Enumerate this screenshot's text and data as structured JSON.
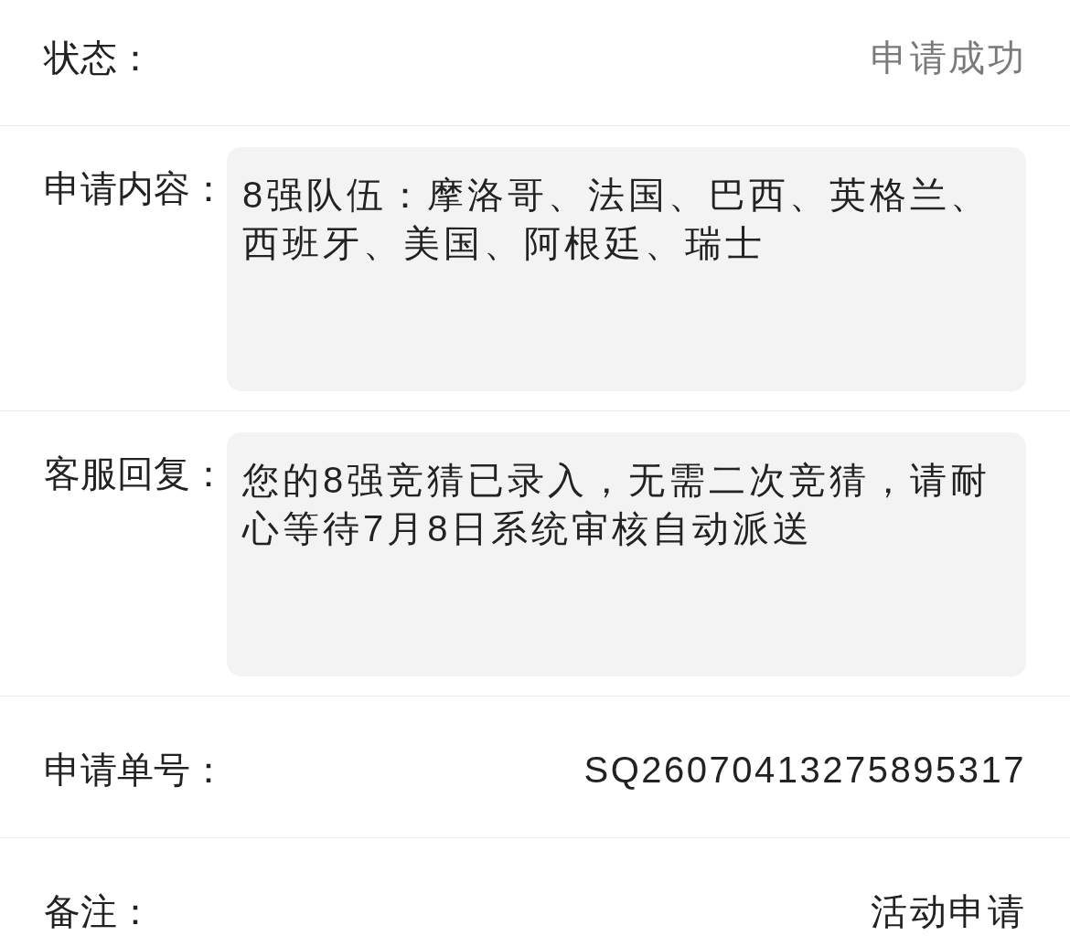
{
  "fields": [
    {
      "kind": "text",
      "label": "状态：",
      "value": "申请成功",
      "muted": true
    },
    {
      "kind": "box",
      "label": "申请内容：",
      "value": "8强队伍：摩洛哥、法国、巴西、英格兰、西班牙、美国、阿根廷、瑞士"
    },
    {
      "kind": "box",
      "label": "客服回复：",
      "value": "您的8强竞猜已录入，无需二次竞猜，请耐心等待7月8日系统审核自动派送"
    },
    {
      "kind": "text",
      "label": "申请单号：",
      "value": "SQ26070413275895317",
      "muted": false
    },
    {
      "kind": "text",
      "label": "备注：",
      "value": "活动申请",
      "muted": false
    }
  ]
}
